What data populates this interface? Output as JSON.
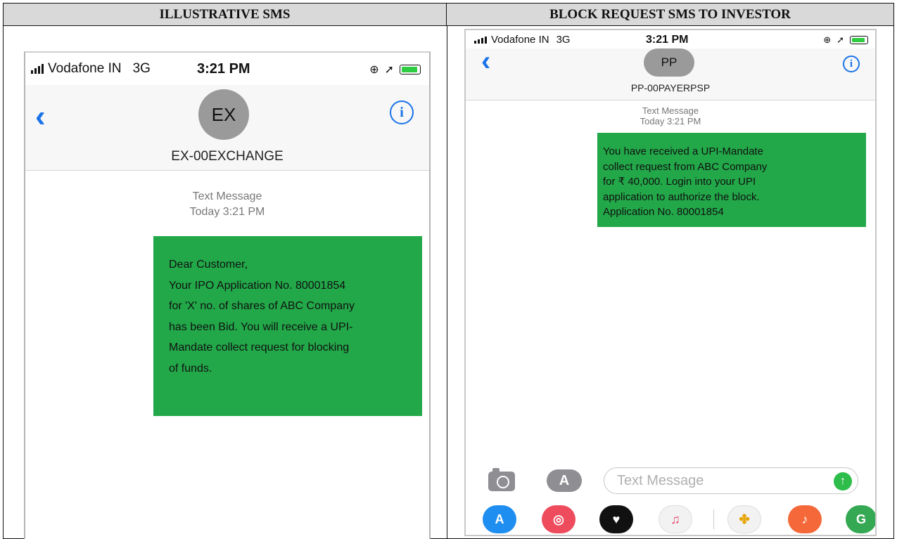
{
  "table": {
    "left_header": "ILLUSTRATIVE SMS",
    "right_header": "BLOCK REQUEST SMS TO INVESTOR"
  },
  "left_phone": {
    "carrier": "Vodafone IN",
    "network": "3G",
    "time": "3:21 PM",
    "avatar_initials": "EX",
    "sender": "EX-00EXCHANGE",
    "meta_line1": "Text Message",
    "meta_line2": "Today 3:21 PM",
    "message_lines": [
      "Dear Customer,",
      "Your IPO Application No. 80001854",
      "for 'X' no. of shares of ABC Company",
      "has been Bid. You will receive a UPI-",
      "Mandate collect request for blocking",
      "of funds."
    ]
  },
  "right_phone": {
    "carrier": "Vodafone IN",
    "network": "3G",
    "time": "3:21 PM",
    "avatar_initials": "PP",
    "sender": "PP-00PAYERPSP",
    "meta_line1": "Text Message",
    "meta_line2": "Today 3:21 PM",
    "message_lines": [
      "You have received a UPI-Mandate",
      "collect request from ABC Company",
      "for ₹ 40,000. Login into your UPI",
      "application to authorize the block.",
      "Application No. 80001854"
    ],
    "input_placeholder": "Text Message"
  },
  "icons": {
    "back": "chevron-left-icon",
    "info": "info-icon",
    "camera": "camera-icon",
    "app_store": "app-store-icon",
    "send": "send-arrow-icon"
  },
  "colors": {
    "bubble": "#22a849",
    "ios_blue": "#1a73e8",
    "header_gray": "#d9d9d9"
  }
}
